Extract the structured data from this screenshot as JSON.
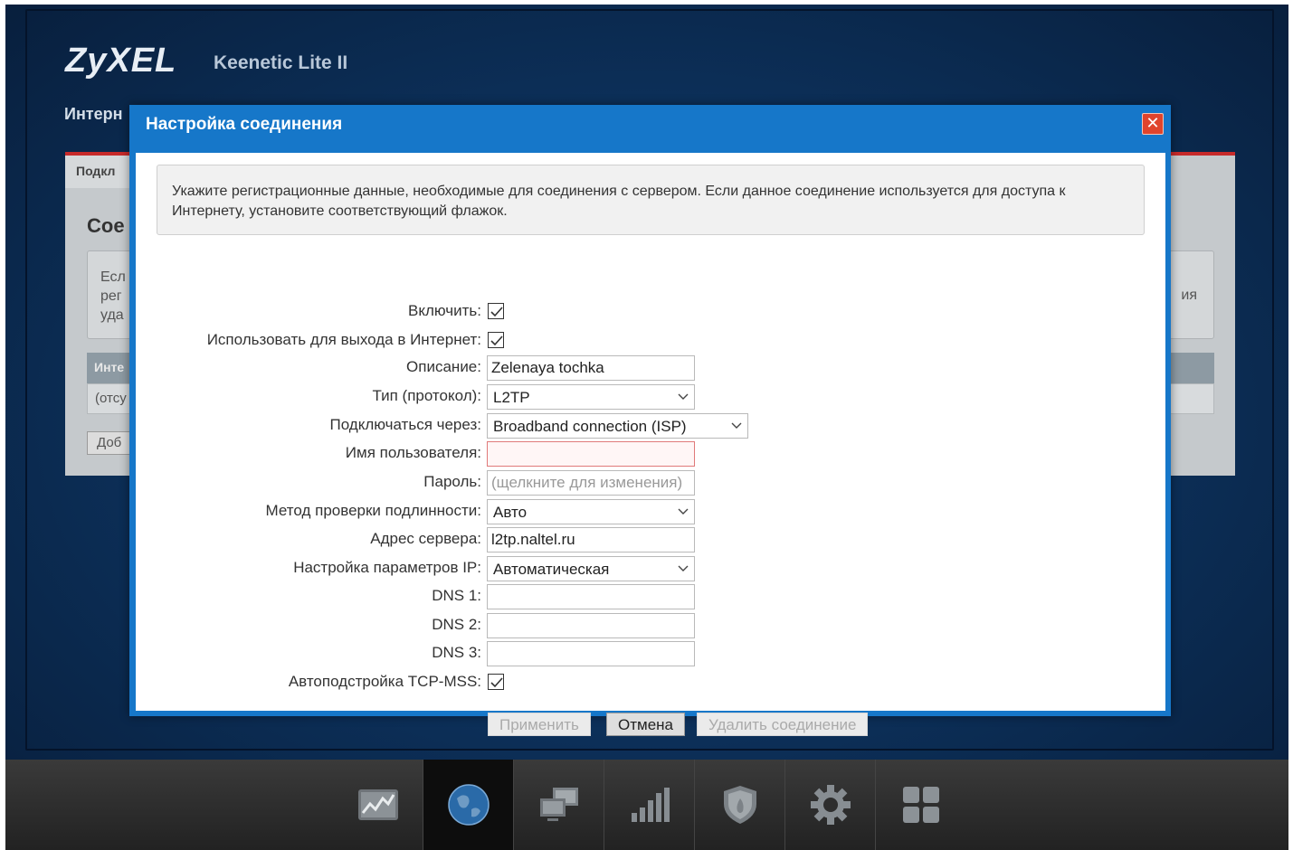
{
  "app": {
    "brand": "ZyXEL",
    "model": "Keenetic Lite II",
    "section_title": "Интерн"
  },
  "background_page": {
    "tab_label": "Подкл",
    "heading": "Сое",
    "info_lines": [
      "Есл",
      "рег",
      "уда"
    ],
    "info_tail": "ия",
    "table_header": "Инте",
    "table_row": "(отсу",
    "add_button": "Доб"
  },
  "dialog": {
    "title": "Настройка соединения",
    "info_text": "Укажите регистрационные данные, необходимые для соединения с сервером. Если данное соединение используется для доступа к Интернету, установите соответствующий флажок.",
    "fields": {
      "enable": {
        "label": "Включить:",
        "checked": true
      },
      "use_for_internet": {
        "label": "Использовать для выхода в Интернет:",
        "checked": true
      },
      "description": {
        "label": "Описание:",
        "value": "Zelenaya tochka"
      },
      "protocol": {
        "label": "Тип (протокол):",
        "value": "L2TP"
      },
      "connect_via": {
        "label": "Подключаться через:",
        "value": "Broadband connection (ISP)"
      },
      "username": {
        "label": "Имя пользователя:",
        "value": ""
      },
      "password": {
        "label": "Пароль:",
        "placeholder": "(щелкните для изменения)"
      },
      "auth_method": {
        "label": "Метод проверки подлинности:",
        "value": "Авто"
      },
      "server_address": {
        "label": "Адрес сервера:",
        "value": "l2tp.naltel.ru"
      },
      "ip_settings": {
        "label": "Настройка параметров IP:",
        "value": "Автоматическая"
      },
      "dns1": {
        "label": "DNS 1:",
        "value": ""
      },
      "dns2": {
        "label": "DNS 2:",
        "value": ""
      },
      "dns3": {
        "label": "DNS 3:",
        "value": ""
      },
      "tcp_mss": {
        "label": "Автоподстройка TCP-MSS:",
        "checked": true
      }
    },
    "buttons": {
      "apply": "Применить",
      "cancel": "Отмена",
      "delete": "Удалить соединение"
    }
  },
  "bottom_nav": {
    "items": [
      {
        "icon": "chart-icon",
        "active": false
      },
      {
        "icon": "globe-icon",
        "active": true
      },
      {
        "icon": "computers-icon",
        "active": false
      },
      {
        "icon": "signal-bars-icon",
        "active": false
      },
      {
        "icon": "shield-icon",
        "active": false
      },
      {
        "icon": "gear-icon",
        "active": false
      },
      {
        "icon": "apps-grid-icon",
        "active": false
      }
    ]
  }
}
